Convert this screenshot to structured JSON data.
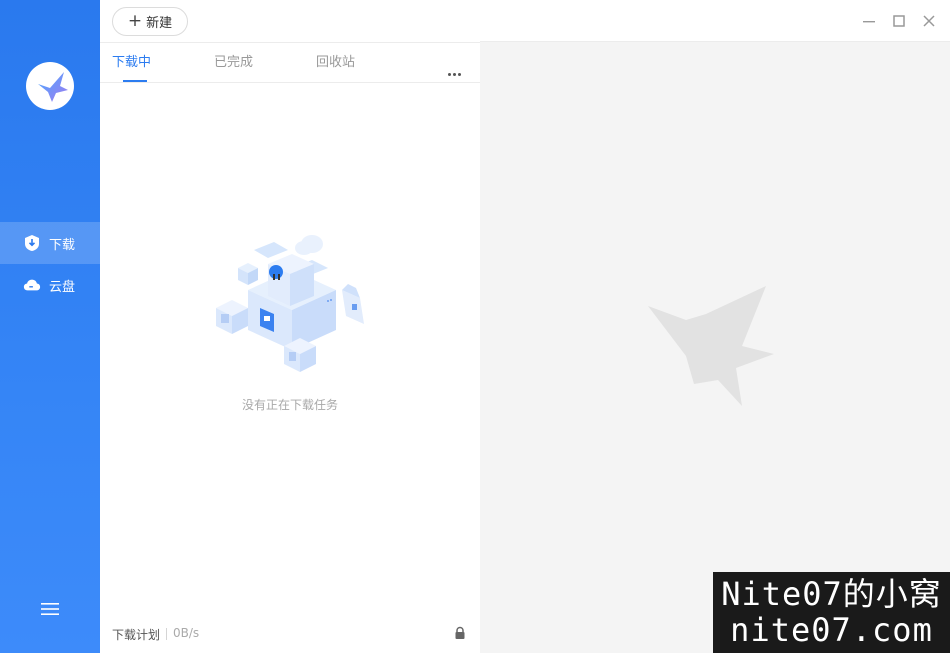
{
  "sidebar": {
    "items": [
      {
        "label": "下载",
        "icon": "download-shield-icon",
        "active": true
      },
      {
        "label": "云盘",
        "icon": "cloud-drive-icon",
        "active": false
      }
    ],
    "menu_icon": "hamburger-menu-icon"
  },
  "toolbar": {
    "new_label": "新建"
  },
  "tabs": [
    {
      "label": "下载中",
      "active": true
    },
    {
      "label": "已完成",
      "active": false
    },
    {
      "label": "回收站",
      "active": false
    }
  ],
  "empty_state": {
    "message": "没有正在下载任务"
  },
  "footer": {
    "plan_label": "下载计划",
    "speed": "0B/s"
  },
  "watermark": {
    "line1": "Nite07的小窝",
    "line2": "nite07.com"
  },
  "colors": {
    "accent": "#2c7cf0",
    "sidebar": "#2a79ee",
    "right_bg": "#f4f4f4"
  }
}
